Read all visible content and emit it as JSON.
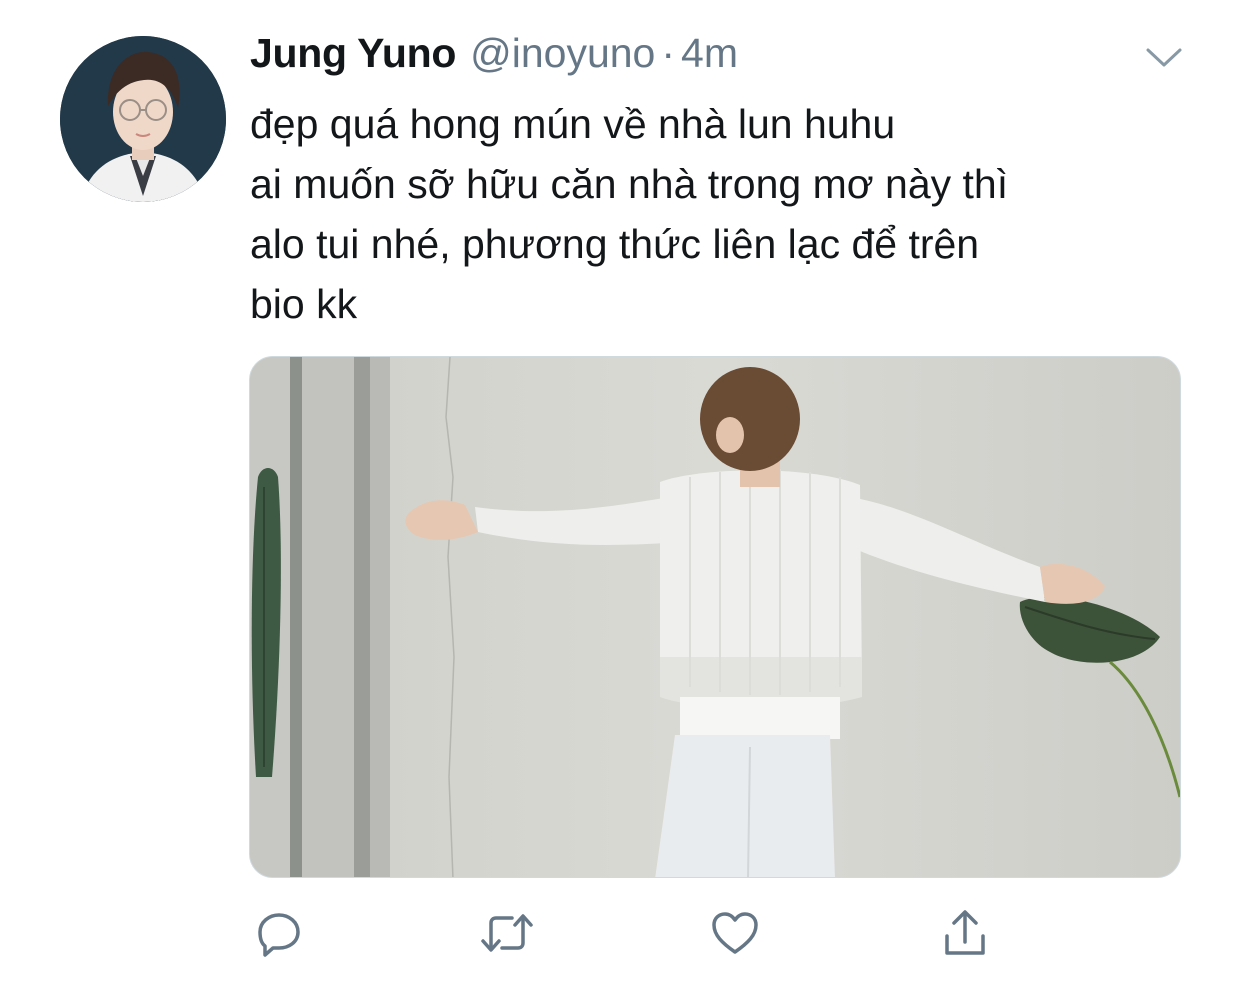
{
  "tweet": {
    "display_name": "Jung Yuno",
    "handle": "@inoyuno",
    "separator": "·",
    "time": "4m",
    "text_lines": [
      "đẹp quá hong mún về nhà lun huhu",
      "ai muốn sỡ hữu căn nhà trong mơ này thì",
      "alo tui nhé, phương thức liên lạc để trên",
      "bio kk"
    ]
  },
  "icons": {
    "more": "chevron-down-icon",
    "reply": "reply-icon",
    "retweet": "retweet-icon",
    "like": "heart-icon",
    "share": "share-icon"
  },
  "colors": {
    "text": "#14171a",
    "secondary": "#657786",
    "icon": "#657786",
    "border": "#cfd9de"
  }
}
